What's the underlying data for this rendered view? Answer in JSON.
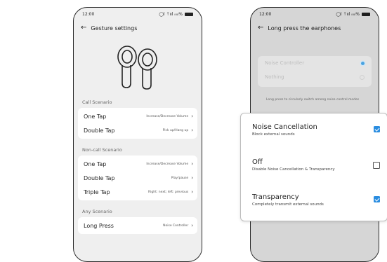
{
  "left_phone": {
    "status_time": "12:00",
    "status_icons": "◯l ⇡ııl ᵢ₀₀%",
    "title": "Gesture settings",
    "sections": [
      {
        "label": "Call Scenario",
        "rows": [
          {
            "name": "One Tap",
            "value": "Increase/Decrease Volume"
          },
          {
            "name": "Double Tap",
            "value": "Pick up/Hang up"
          }
        ]
      },
      {
        "label": "Non-call Scenario",
        "rows": [
          {
            "name": "One Tap",
            "value": "Increase/Decrease Volume"
          },
          {
            "name": "Double Tap",
            "value": "Play/pause"
          },
          {
            "name": "Triple Tap",
            "value": "Right: next; left: previous"
          }
        ]
      },
      {
        "label": "Any Scenario",
        "rows": [
          {
            "name": "Long Press",
            "value": "Noise Controller"
          }
        ]
      }
    ]
  },
  "right_phone": {
    "status_time": "12:00",
    "status_icons": "◯l ⇡ııl ᵢ₀₀%",
    "title": "Long press the earphones",
    "options": [
      {
        "label": "Noise Controller",
        "selected": true
      },
      {
        "label": "Nothing",
        "selected": false
      }
    ],
    "hint": "Long press to circularly switch among noise control modes"
  },
  "popup": {
    "items": [
      {
        "title": "Noise Cancellation",
        "subtitle": "Block external sounds",
        "checked": true
      },
      {
        "title": "Off",
        "subtitle": "Disable Noise Cancellation & Transparency",
        "checked": false
      },
      {
        "title": "Transparency",
        "subtitle": "Completely transmit external sounds",
        "checked": true
      }
    ]
  },
  "colors": {
    "accent": "#2a8de0",
    "screen_bg": "#efefef",
    "card_bg": "#ffffff"
  }
}
